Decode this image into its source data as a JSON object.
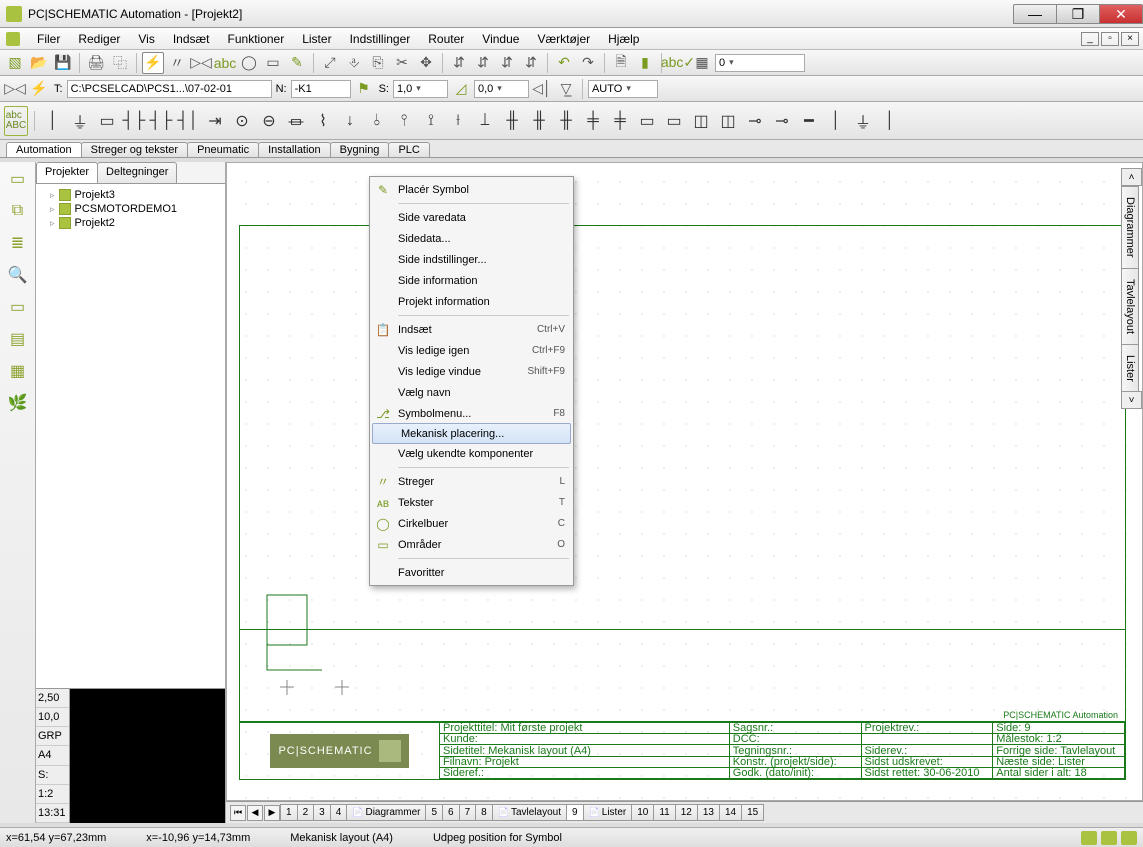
{
  "title": "PC|SCHEMATIC Automation - [Projekt2]",
  "menu": [
    "Filer",
    "Rediger",
    "Vis",
    "Indsæt",
    "Funktioner",
    "Lister",
    "Indstillinger",
    "Router",
    "Vindue",
    "Værktøjer",
    "Hjælp"
  ],
  "toolbar2": {
    "t_label": "T:",
    "t_value": "C:\\PCSELCAD\\PCS1...\\07-02-01",
    "n_label": "N:",
    "n_value": "-K1",
    "s_label": "S:",
    "s_value": "1,0",
    "coord": "0,0",
    "auto": "AUTO",
    "numbox": "0"
  },
  "symtabs": [
    "Automation",
    "Streger og tekster",
    "Pneumatic",
    "Installation",
    "Bygning",
    "PLC"
  ],
  "side_tabs": [
    "Projekter",
    "Deltegninger"
  ],
  "tree": [
    "Projekt3",
    "PCSMOTORDEMO1",
    "Projekt2"
  ],
  "sideinfo": [
    "2,50",
    "10,0",
    "GRP",
    "A4",
    "S:",
    "1:2",
    "13:31"
  ],
  "righttabs": [
    "Diagrammer",
    "Tavlelayout",
    "Lister"
  ],
  "ctx": [
    {
      "label": "Placér Symbol",
      "icon": "✎"
    },
    {
      "sep": true
    },
    {
      "label": "Side varedata"
    },
    {
      "label": "Sidedata..."
    },
    {
      "label": "Side indstillinger..."
    },
    {
      "label": "Side information"
    },
    {
      "label": "Projekt information"
    },
    {
      "sep": true
    },
    {
      "label": "Indsæt",
      "sc": "Ctrl+V",
      "icon": "📋"
    },
    {
      "label": "Vis ledige igen",
      "sc": "Ctrl+F9"
    },
    {
      "label": "Vis ledige vindue",
      "sc": "Shift+F9"
    },
    {
      "label": "Vælg navn"
    },
    {
      "label": "Symbolmenu...",
      "sc": "F8",
      "icon": "⎇"
    },
    {
      "label": "Mekanisk placering...",
      "hl": true
    },
    {
      "label": "Vælg ukendte komponenter"
    },
    {
      "sep": true
    },
    {
      "label": "Streger",
      "sc": "L",
      "icon": "〃"
    },
    {
      "label": "Tekster",
      "sc": "T",
      "icon": "ᴀʙ"
    },
    {
      "label": "Cirkelbuer",
      "sc": "C",
      "icon": "◯"
    },
    {
      "label": "Områder",
      "sc": "O",
      "icon": "▭"
    },
    {
      "sep": true
    },
    {
      "label": "Favoritter"
    }
  ],
  "titleblock": {
    "brand": "PC|SCHEMATIC",
    "company": "PC|SCHEMATIC Automation",
    "rows": [
      [
        "Projekttitel: Mit første projekt",
        "Sagsnr.:",
        "Projektrev.:",
        "Side: 9"
      ],
      [
        "Kunde:",
        "DCC:",
        "",
        "Målestok: 1:2"
      ],
      [
        "Sidetitel: Mekanisk layout (A4)",
        "Tegningsnr.:",
        "Siderev.:",
        "Forrige side: Tavlelayout"
      ],
      [
        "Filnavn: Projekt",
        "Konstr. (projekt/side):",
        "Sidst udskrevet:",
        "Næste side: Lister"
      ],
      [
        "Sideref.:",
        "Godk. (dato/init):",
        "Sidst rettet: 30-06-2010",
        "Antal sider i alt: 18"
      ]
    ]
  },
  "pagetabs": [
    "1",
    "2",
    "3",
    "4",
    "Diagrammer",
    "5",
    "6",
    "7",
    "8",
    "Tavlelayout",
    "9",
    "Lister",
    "10",
    "11",
    "12",
    "13",
    "14",
    "15"
  ],
  "pagetabs_active": "9",
  "status": {
    "xy1": "x=61,54 y=67,23mm",
    "xy2": "x=-10,96 y=14,73mm",
    "layout": "Mekanisk layout (A4)",
    "msg": "Udpeg position for Symbol"
  }
}
